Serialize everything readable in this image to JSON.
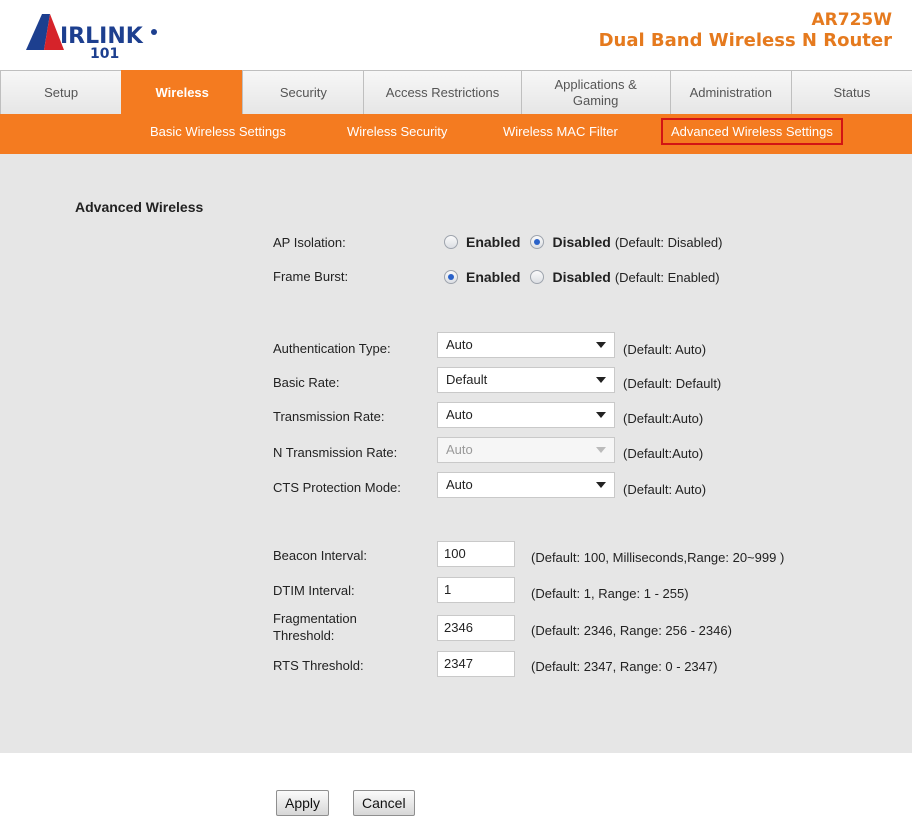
{
  "header": {
    "logo_text": "AIRLINK 101",
    "model": "AR725W",
    "product": "Dual Band Wireless N Router"
  },
  "tabs": [
    {
      "label": "Setup"
    },
    {
      "label": "Wireless",
      "active": true
    },
    {
      "label": "Security"
    },
    {
      "label": "Access Restrictions"
    },
    {
      "label": "Applications & Gaming"
    },
    {
      "label": "Administration"
    },
    {
      "label": "Status"
    }
  ],
  "subnav": [
    {
      "label": "Basic Wireless Settings"
    },
    {
      "label": "Wireless Security"
    },
    {
      "label": "Wireless MAC Filter"
    },
    {
      "label": "Advanced Wireless Settings",
      "highlighted": true
    }
  ],
  "section_title": "Advanced Wireless",
  "radios": {
    "ap_isolation": {
      "label": "AP Isolation:",
      "enabled": "Enabled",
      "disabled": "Disabled",
      "default": "(Default: Disabled)",
      "selected": "Disabled"
    },
    "frame_burst": {
      "label": "Frame Burst:",
      "enabled": "Enabled",
      "disabled": "Disabled",
      "default": "(Default: Enabled)",
      "selected": "Enabled"
    }
  },
  "selects": {
    "auth_type": {
      "label": "Authentication Type:",
      "value": "Auto",
      "default": "(Default: Auto)"
    },
    "basic_rate": {
      "label": "Basic Rate:",
      "value": "Default",
      "default": "(Default: Default)"
    },
    "tx_rate": {
      "label": "Transmission Rate:",
      "value": "Auto",
      "default": "(Default:Auto)"
    },
    "n_tx_rate": {
      "label": "N Transmission Rate:",
      "value": "Auto",
      "default": "(Default:Auto)",
      "disabled": true
    },
    "cts_mode": {
      "label": "CTS Protection Mode:",
      "value": "Auto",
      "default": "(Default: Auto)"
    }
  },
  "fields": {
    "beacon": {
      "label": "Beacon Interval:",
      "value": "100",
      "default": "(Default: 100, Milliseconds,Range: 20~999 )"
    },
    "dtim": {
      "label": "DTIM Interval:",
      "value": "1",
      "default": "(Default: 1, Range: 1 - 255)"
    },
    "frag_line1": "Fragmentation",
    "frag_line2": "Threshold:",
    "frag": {
      "value": "2346",
      "default": "(Default: 2346, Range: 256 - 2346)"
    },
    "rts": {
      "label": "RTS Threshold:",
      "value": "2347",
      "default": "(Default: 2347, Range: 0 - 2347)"
    }
  },
  "buttons": {
    "apply": "Apply",
    "cancel": "Cancel"
  },
  "colors": {
    "accent": "#f47b20",
    "highlight_border": "#d21414",
    "panel": "#e6e6e6"
  }
}
